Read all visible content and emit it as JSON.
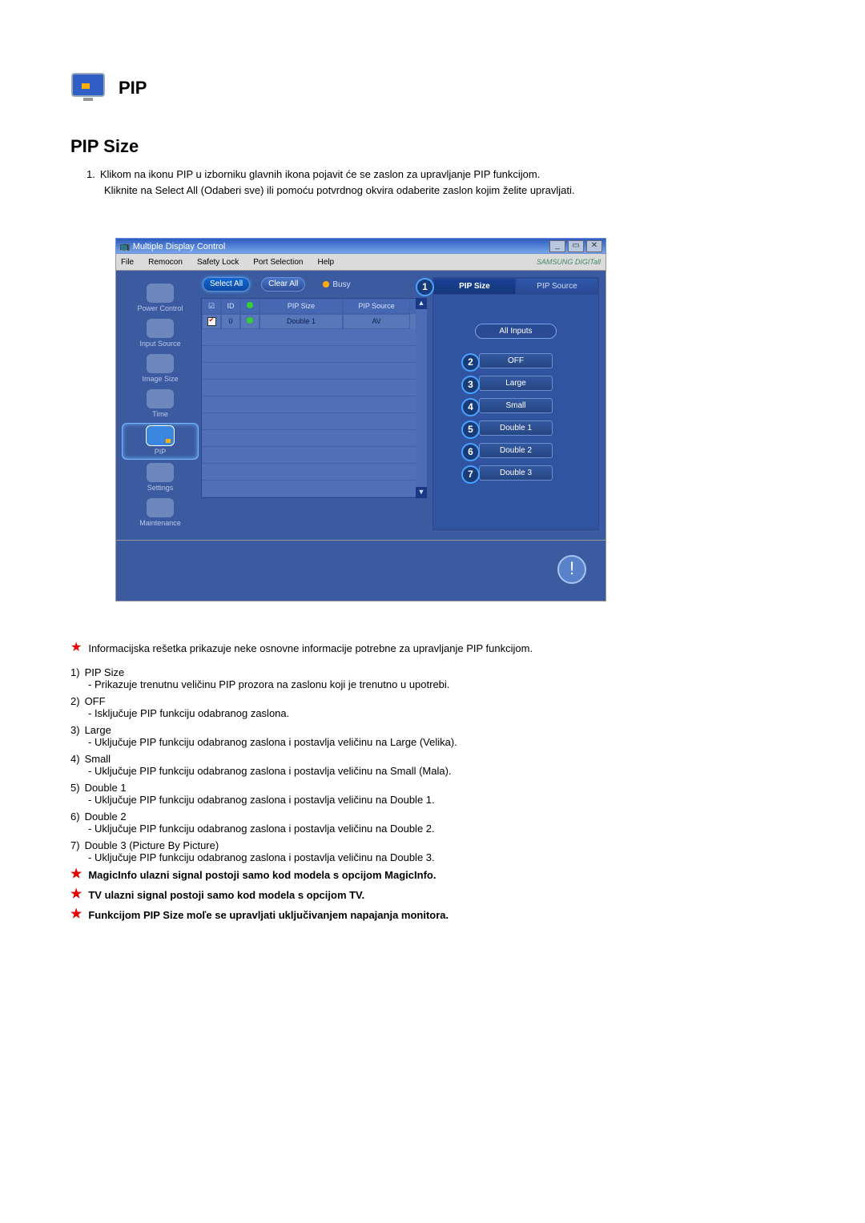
{
  "header": {
    "title": "PIP"
  },
  "section": {
    "title": "PIP Size"
  },
  "intro": {
    "num": "1.",
    "line1": "Klikom na ikonu PIP u izborniku glavnih ikona pojavit će se zaslon za upravljanje PIP funkcijom.",
    "line2": "Kliknite na Select All (Odaberi sve) ili pomoću potvrdnog okvira odaberite zaslon kojim želite upravljati."
  },
  "app": {
    "window_title": "Multiple Display Control",
    "menus": [
      "File",
      "Remocon",
      "Safety Lock",
      "Port Selection",
      "Help"
    ],
    "brand": "SAMSUNG DIGITall",
    "nav": [
      "Power Control",
      "Input Source",
      "Image Size",
      "Time",
      "PIP",
      "Settings",
      "Maintenance"
    ],
    "buttons": {
      "select_all": "Select All",
      "clear_all": "Clear All",
      "busy": "Busy"
    },
    "grid": {
      "headers": {
        "chk": "☑",
        "id": "ID",
        "st": "●",
        "size": "PIP Size",
        "source": "PIP Source"
      },
      "row": {
        "id": "0",
        "size": "Double 1",
        "source": "AV"
      }
    },
    "right": {
      "tab1": "PIP Size",
      "tab2": "PIP Source",
      "subtitle": "All Inputs",
      "opts": [
        "OFF",
        "Large",
        "Small",
        "Double 1",
        "Double 2",
        "Double 3"
      ]
    }
  },
  "callouts": [
    "1",
    "2",
    "3",
    "4",
    "5",
    "6",
    "7"
  ],
  "notes": {
    "star_intro": "Informacijska rešetka prikazuje neke osnovne informacije potrebne za upravljanje PIP funkcijom.",
    "items": [
      {
        "n": "1)",
        "t": "PIP Size",
        "d": "- Prikazuje trenutnu veličinu PIP prozora na zaslonu koji je trenutno u upotrebi."
      },
      {
        "n": "2)",
        "t": "OFF",
        "d": "- Isključuje PIP funkciju odabranog zaslona."
      },
      {
        "n": "3)",
        "t": "Large",
        "d": "- Uključuje PIP funkciju odabranog zaslona i postavlja veličinu na Large (Velika)."
      },
      {
        "n": "4)",
        "t": "Small",
        "d": "- Uključuje PIP funkciju odabranog zaslona i postavlja veličinu na Small (Mala)."
      },
      {
        "n": "5)",
        "t": "Double 1",
        "d": "- Uključuje PIP funkciju odabranog zaslona i postavlja veličinu na Double 1."
      },
      {
        "n": "6)",
        "t": "Double 2",
        "d": "- Uključuje PIP funkciju odabranog zaslona i postavlja veličinu na Double 2."
      },
      {
        "n": "7)",
        "t": "Double 3 (Picture By Picture)",
        "d": "- Uključuje PIP funkciju odabranog zaslona i postavlja veličinu na Double 3."
      }
    ],
    "bold_stars": [
      "MagicInfo ulazni signal postoji samo kod modela s opcijom MagicInfo.",
      "TV ulazni signal postoji samo kod modela s opcijom TV.",
      "Funkcijom PIP Size moľe se upravljati uključivanjem napajanja monitora."
    ]
  }
}
